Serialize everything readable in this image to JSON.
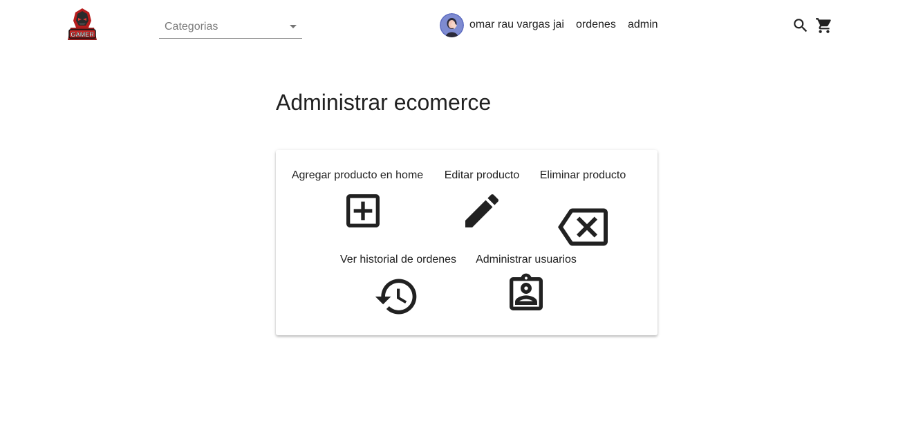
{
  "header": {
    "logo_text": "GAMER",
    "categories_placeholder": "Categorias",
    "user_name": "omar rau vargas jai",
    "orders_link": "ordenes",
    "admin_link": "admin",
    "search_icon": "search-icon",
    "cart_icon": "shopping-cart-icon"
  },
  "main": {
    "title": "Administrar ecomerce",
    "actions": [
      {
        "label": "Agregar producto en home",
        "icon": "add-box-icon"
      },
      {
        "label": "Editar producto",
        "icon": "edit-pencil-icon"
      },
      {
        "label": "Eliminar producto",
        "icon": "backspace-icon"
      },
      {
        "label": "Ver historial de ordenes",
        "icon": "history-icon"
      },
      {
        "label": "Administrar usuarios",
        "icon": "contact-badge-icon"
      }
    ]
  },
  "colors": {
    "text": "#212121",
    "placeholder": "#7a7a7a",
    "logo_red": "#c62828"
  }
}
